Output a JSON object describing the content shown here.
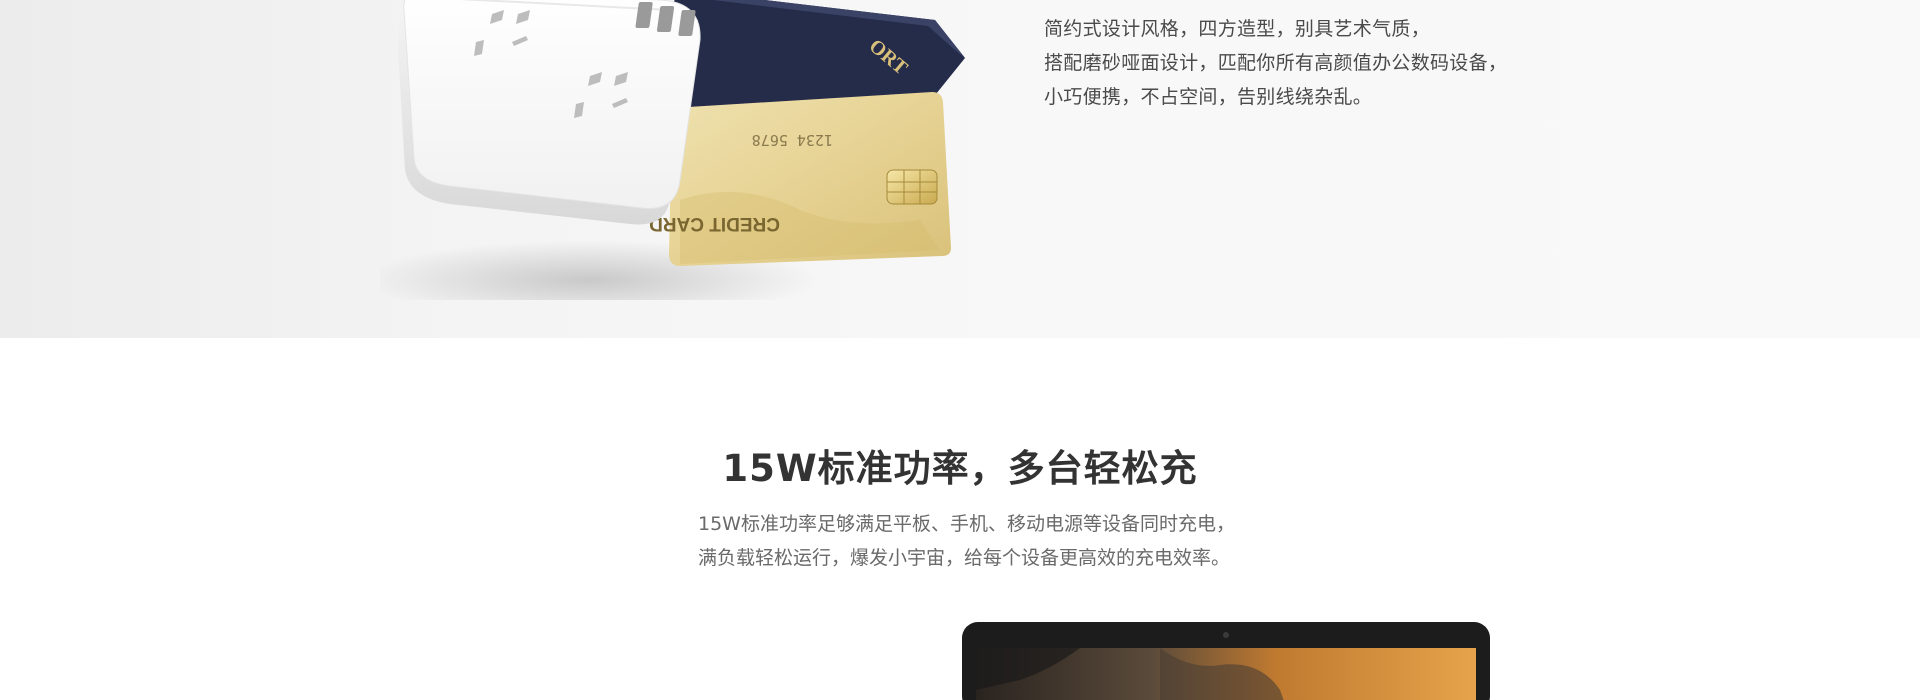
{
  "hero": {
    "description_lines": [
      "简约式设计风格，四方造型，别具艺术气质，",
      "搭配磨砂哑面设计，匹配你所有高颜值办公数码设备，",
      "小巧便携，不占空间，告别线绕杂乱。"
    ],
    "illustration": {
      "passport_text": "ORT",
      "card_number": "1234 5678",
      "card_text": "CREDIT CARD"
    }
  },
  "power_section": {
    "title": "15W标准功率，多台轻松充",
    "description_lines": [
      "15W标准功率足够满足平板、手机、移动电源等设备同时充电，",
      "满负载轻松运行，爆发小宇宙，给每个设备更高效的充电效率。"
    ]
  }
}
